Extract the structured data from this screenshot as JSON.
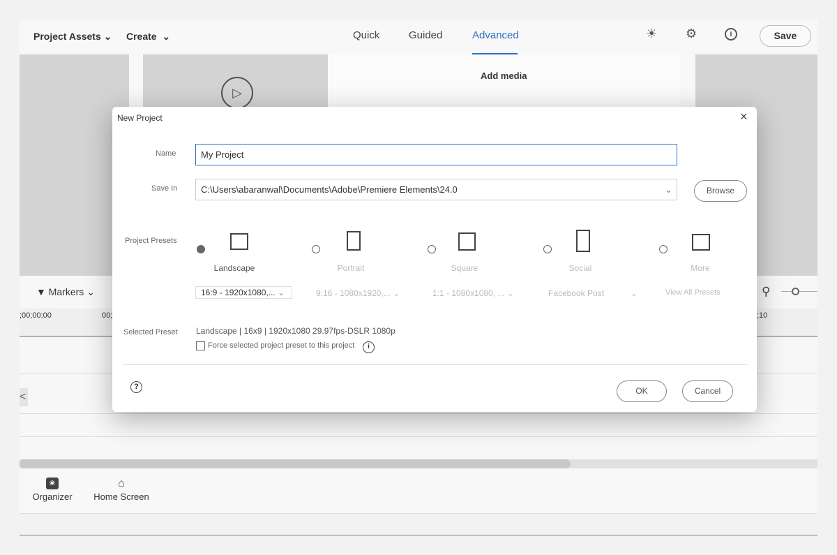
{
  "topbar": {
    "project_assets": "Project Assets",
    "create": "Create",
    "tabs": [
      "Quick",
      "Guided",
      "Advanced"
    ],
    "active_tab": "Advanced",
    "save": "Save",
    "accent": "#2a72c4"
  },
  "media_panel": {
    "add_media": "Add media"
  },
  "timeline": {
    "markers": "Markers",
    "timecode_start": ";00;00;00",
    "timecode_mid": "00;",
    "timecode_end": ";10"
  },
  "bottom": {
    "organizer": "Organizer",
    "home_screen": "Home Screen"
  },
  "dialog": {
    "title": "New Project",
    "name_label": "Name",
    "name_value": "My Project",
    "save_in_label": "Save In",
    "save_in_value": "C:\\Users\\abaranwal\\Documents\\Adobe\\Premiere Elements\\24.0",
    "browse": "Browse",
    "presets_label": "Project Presets",
    "presets": [
      {
        "name": "Landscape",
        "option": "16:9 - 1920x1080,...",
        "selected": true
      },
      {
        "name": "Portrait",
        "option": "9:16 - 1080x1920,...",
        "selected": false
      },
      {
        "name": "Square",
        "option": "1:1 - 1080x1080, ...",
        "selected": false
      },
      {
        "name": "Social",
        "option": "Facebook Post",
        "selected": false
      },
      {
        "name": "More",
        "option": "View All Presets",
        "selected": false
      }
    ],
    "selected_preset_label": "Selected Preset",
    "selected_preset_value": "Landscape | 16x9 | 1920x1080 29.97fps-DSLR 1080p",
    "force_label": "Force selected project preset to this project",
    "force_checked": false,
    "ok": "OK",
    "cancel": "Cancel"
  }
}
